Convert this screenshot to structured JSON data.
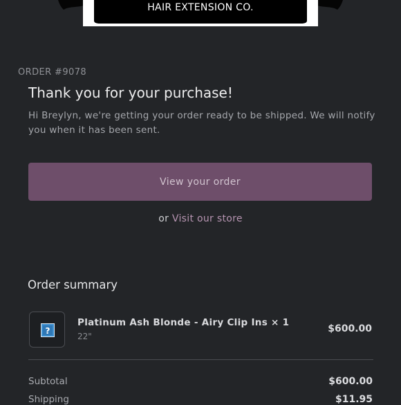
{
  "brand": {
    "logo_text": "HAIR EXTENSION CO."
  },
  "order": {
    "number_label": "ORDER #9078",
    "heading": "Thank you for your purchase!",
    "message": "Hi Breylyn, we're getting your order ready to be shipped. We will notify you when it has been sent.",
    "view_button_label": "View your order",
    "alt_prefix": "or",
    "store_link_label": "Visit our store"
  },
  "summary": {
    "title": "Order summary",
    "items": [
      {
        "name": "Platinum Ash Blonde - Airy Clip Ins × 1",
        "variant": "22\"",
        "price": "$600.00",
        "image_icon": "broken-image-placeholder-icon"
      }
    ],
    "subtotal_label": "Subtotal",
    "subtotal_value": "$600.00",
    "shipping_label": "Shipping",
    "shipping_value": "$11.95"
  },
  "colors": {
    "background": "#232528",
    "button": "#6e4e6a",
    "link": "#b694b1"
  }
}
